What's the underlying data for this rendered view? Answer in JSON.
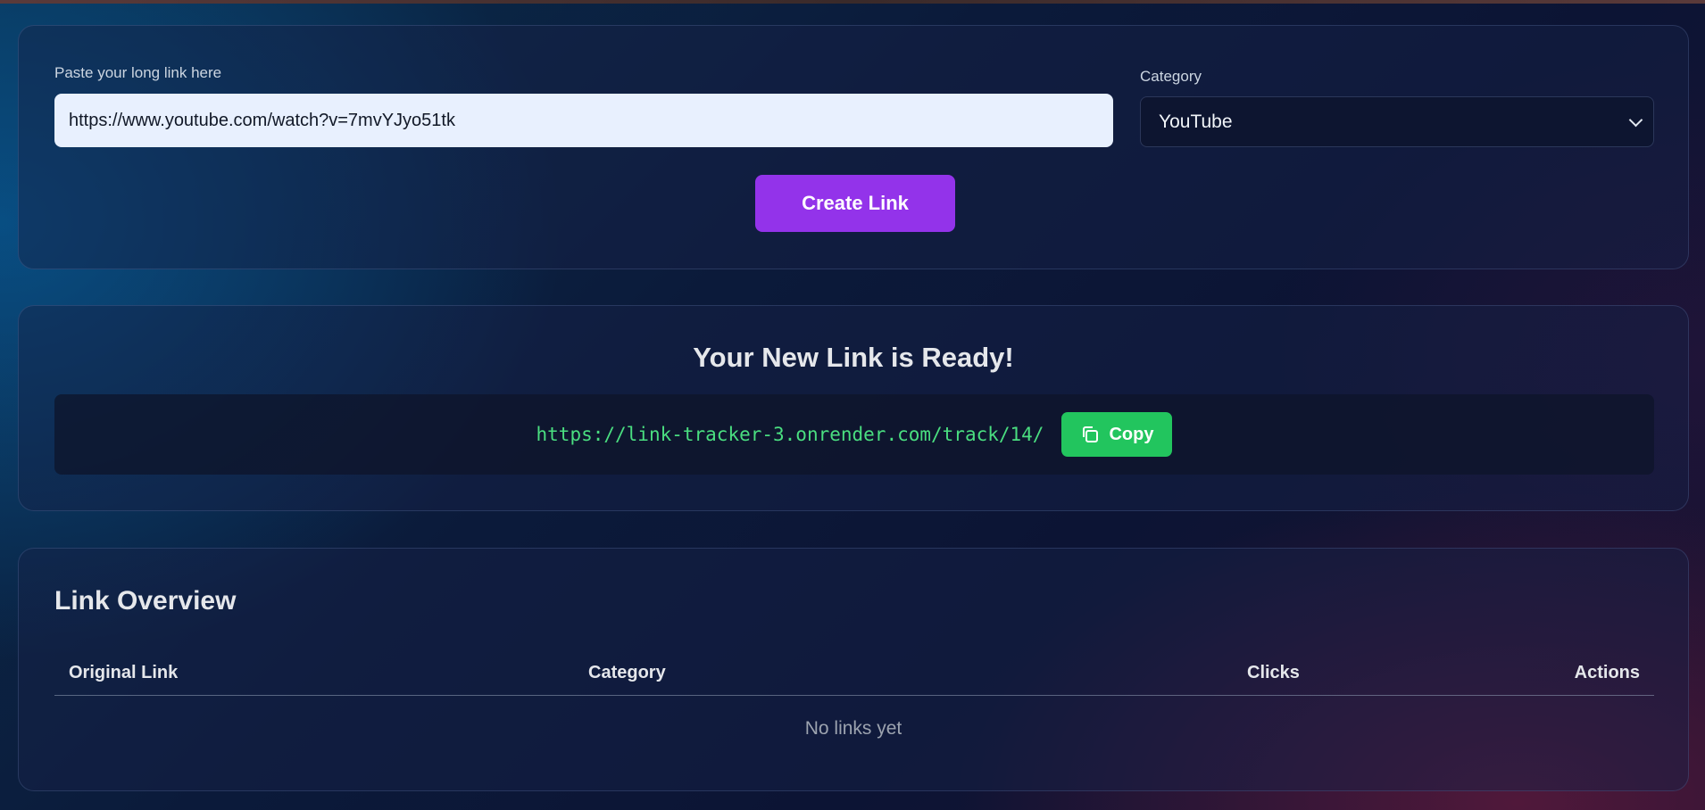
{
  "create_form": {
    "url_label": "Paste your long link here",
    "url_value": "https://www.youtube.com/watch?v=7mvYJyo51tk",
    "category_label": "Category",
    "category_selected": "YouTube",
    "create_button": "Create Link"
  },
  "result": {
    "title": "Your New Link is Ready!",
    "short_link": "https://link-tracker-3.onrender.com/track/14/",
    "copy_button": "Copy"
  },
  "overview": {
    "title": "Link Overview",
    "columns": [
      "Original Link",
      "Category",
      "Clicks",
      "Actions"
    ],
    "empty_message": "No links yet"
  },
  "colors": {
    "primary_button": "#9333ea",
    "success_button": "#22c55e",
    "link_text": "#4ade80"
  },
  "icons": {
    "copy": "copy-icon",
    "select_arrow": "chevron-down-icon"
  }
}
